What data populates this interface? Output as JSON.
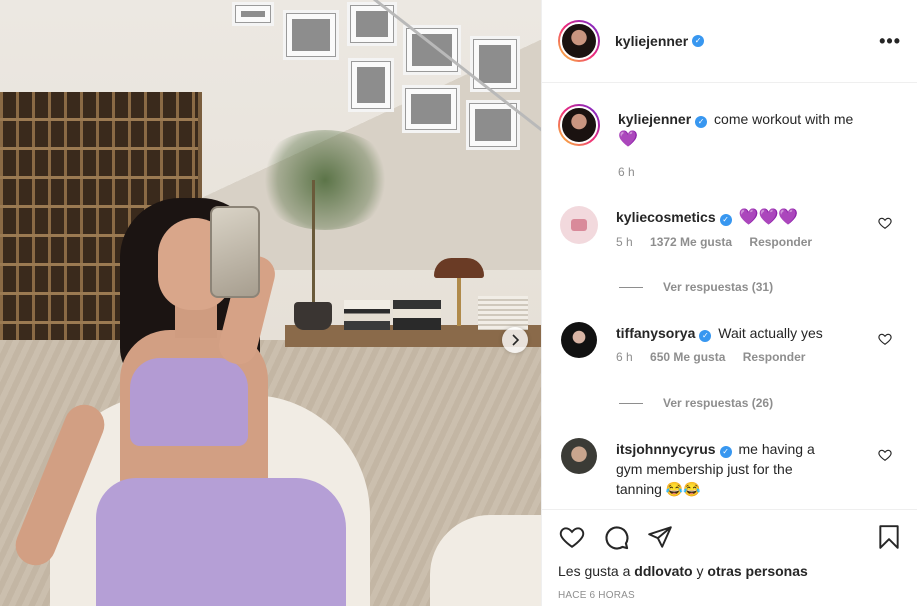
{
  "header": {
    "username": "kyliejenner",
    "more_label": "•••"
  },
  "caption": {
    "username": "kyliejenner",
    "text": "come workout with me",
    "emoji": "💜",
    "time": "6 h"
  },
  "comments": [
    {
      "username": "kyliecosmetics",
      "text": "💜💜💜",
      "time": "5 h",
      "likes": "1372 Me gusta",
      "reply": "Responder",
      "view_replies": "Ver respuestas (31)"
    },
    {
      "username": "tiffanysorya",
      "text": "Wait actually yes",
      "time": "6 h",
      "likes": "650 Me gusta",
      "reply": "Responder",
      "view_replies": "Ver respuestas (26)"
    },
    {
      "username": "itsjohnnycyrus",
      "text": "me having a gym membership just for the tanning 😂😂"
    }
  ],
  "likes": {
    "prefix": "Les gusta a",
    "user": "ddlovato",
    "conj": "y",
    "others": "otras personas"
  },
  "timestamp": "HACE 6 HORAS",
  "icons": [
    "heart-icon",
    "comment-icon",
    "share-icon",
    "bookmark-icon",
    "chevron-right-icon",
    "verified-badge-icon"
  ]
}
